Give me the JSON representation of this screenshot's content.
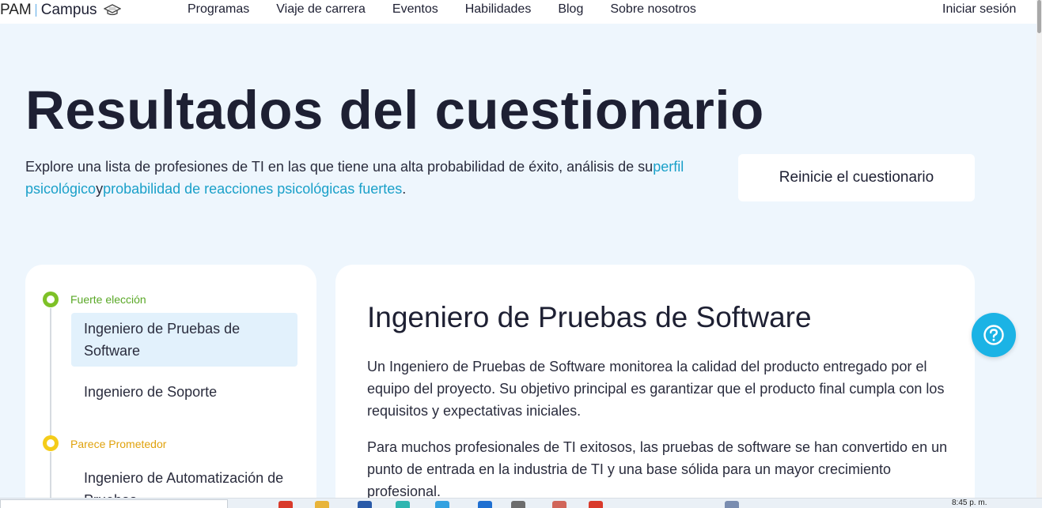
{
  "nav": {
    "logo_brand": "PAM",
    "logo_campus": "Campus",
    "links": [
      "Programas",
      "Viaje de carrera",
      "Eventos",
      "Habilidades",
      "Blog",
      "Sobre nosotros"
    ],
    "signin": "Iniciar sesión"
  },
  "hero": {
    "title": "Resultados del cuestionario",
    "intro_prefix": "Explore una lista de profesiones de TI en las que tiene una alta probabilidad de éxito, análisis de su",
    "link_profile": "perfil psicológico",
    "intro_mid": "y",
    "link_reactions": "probabilidad de reacciones psicológicas fuertes",
    "intro_suffix": ".",
    "reset_button": "Reinicie el cuestionario"
  },
  "sidebar": {
    "groups": [
      {
        "label": "Fuerte elección",
        "color": "#7ec127",
        "items": [
          "Ingeniero de Pruebas de Software",
          "Ingeniero de Soporte"
        ]
      },
      {
        "label": "Parece Prometedor",
        "color": "#f4cc1a",
        "items": [
          "Ingeniero de Automatización de Pruebas"
        ]
      }
    ]
  },
  "detail": {
    "title": "Ingeniero de Pruebas de Software",
    "paragraphs": [
      "Un Ingeniero de Pruebas de Software monitorea la calidad del producto entregado por el equipo del proyecto. Su objetivo principal es garantizar que el producto final cumpla con los requisitos y expectativas iniciales.",
      "Para muchos profesionales de TI exitosos, las pruebas de software se han convertido en un punto de entrada en la industria de TI y una base sólida para un mayor crecimiento profesional."
    ]
  },
  "help_icon": "question-circle-icon",
  "taskbar": {
    "clock": "8:45 p. m."
  }
}
